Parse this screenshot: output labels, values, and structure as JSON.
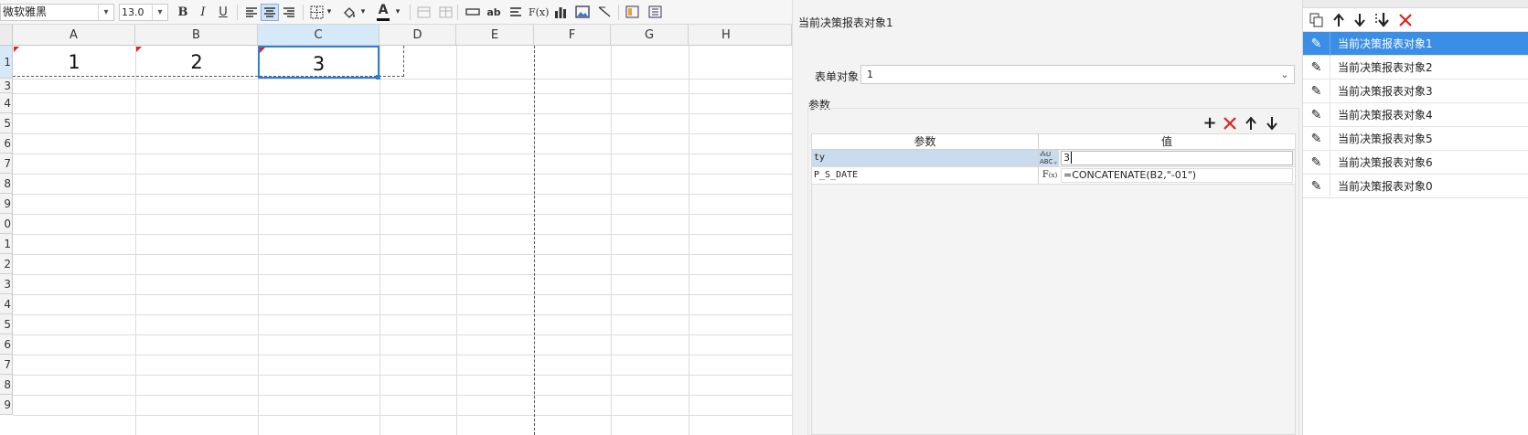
{
  "toolbar": {
    "font_name": "微软雅黑",
    "font_size": "13.0",
    "bold": "B",
    "italic": "I",
    "underline": "U",
    "text_color_glyph": "A",
    "wrap_label": "ab",
    "formula_label": "F(x)"
  },
  "sheet": {
    "columns": [
      "A",
      "B",
      "C",
      "D",
      "E",
      "F",
      "G",
      "H"
    ],
    "selected_column": "C",
    "rows": [
      "1",
      "3",
      "4",
      "5",
      "6",
      "7",
      "8",
      "9",
      "0",
      "1",
      "2",
      "3",
      "4",
      "5",
      "6",
      "7",
      "8",
      "9"
    ],
    "cells": [
      {
        "ref": "A1",
        "value": "1"
      },
      {
        "ref": "B1",
        "value": "2"
      },
      {
        "ref": "C1",
        "value": "3"
      }
    ]
  },
  "dialog": {
    "title": "当前决策报表对象1",
    "form_object_label": "表单对象",
    "form_object_value": "1",
    "params_section_label": "参数",
    "table_header_param": "参数",
    "table_header_value": "值",
    "params": [
      {
        "name": "ty",
        "type_icon": "text-type-icon",
        "value": "3"
      },
      {
        "name": "P_S_DATE",
        "type_icon": "formula-type-icon",
        "value": "=CONCATENATE(B2,\"-01\")"
      }
    ]
  },
  "object_list": {
    "items": [
      {
        "label": "当前决策报表对象1",
        "selected": true
      },
      {
        "label": "当前决策报表对象2",
        "selected": false
      },
      {
        "label": "当前决策报表对象3",
        "selected": false
      },
      {
        "label": "当前决策报表对象4",
        "selected": false
      },
      {
        "label": "当前决策报表对象5",
        "selected": false
      },
      {
        "label": "当前决策报表对象6",
        "selected": false
      },
      {
        "label": "当前决策报表对象0",
        "selected": false
      }
    ]
  },
  "colors": {
    "selection_blue": "#3a8ee6",
    "delete_red": "#e02020",
    "selected_header": "#d6e9f8"
  }
}
